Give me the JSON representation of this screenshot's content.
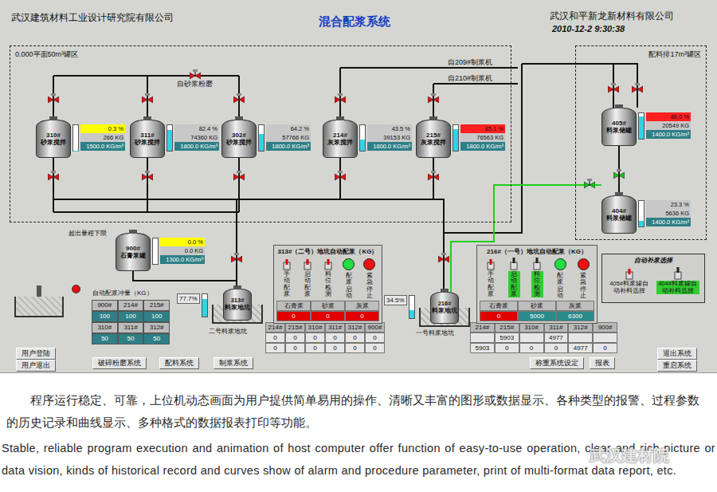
{
  "header": {
    "left_company": "武汉建筑材料工业设计研究院有限公司",
    "title": "混合配浆系统",
    "right_company": "武汉和平新龙新材料有限公司",
    "datetime": "2010-12-2 9:30:38"
  },
  "zones": [
    {
      "label": "0.000平面50m³罐区"
    },
    {
      "label": "配料排17m³罐区"
    }
  ],
  "sources": [
    "自砂浆粉磨",
    "自209#制浆机",
    "自210#制浆机"
  ],
  "alarm_text": "超出量程下限",
  "tanks": [
    {
      "id": "310#",
      "name": "砂浆搅拌",
      "percent": "0.3 %",
      "weight": "266 KG",
      "density": "1500.0 KG/m³",
      "level": 0.003,
      "color": "#ffff00"
    },
    {
      "id": "311#",
      "name": "砂浆搅拌",
      "percent": "82.4 %",
      "weight": "74360 KG",
      "density": "1800.0 KG/m³",
      "level": 0.824,
      "color": "#c8c8c8"
    },
    {
      "id": "302#",
      "name": "砂浆搅拌",
      "percent": "64.2 %",
      "weight": "57766 KG",
      "density": "1800.0 KG/m³",
      "level": 0.642,
      "color": "#c8c8c8"
    },
    {
      "id": "214#",
      "name": "灰浆搅拌",
      "percent": "43.5 %",
      "weight": "39153 KG",
      "density": "1800.0 KG/m³",
      "level": 0.435,
      "color": "#c8c8c8"
    },
    {
      "id": "215#",
      "name": "灰浆搅拌",
      "percent": "85.1 %",
      "weight": "76563 KG",
      "density": "1800.0 KG/m³",
      "level": 0.851,
      "color": "#ff2020"
    },
    {
      "id": "405#",
      "name": "料浆储罐",
      "percent": "86.0 %",
      "weight": "20549 KG",
      "density": "1400.0 KG/m³",
      "level": 0.86,
      "color": "#ff2020"
    },
    {
      "id": "404#",
      "name": "料浆储罐",
      "percent": "23.3 %",
      "weight": "5636 KG",
      "density": "1400.0 KG/m³",
      "level": 0.233,
      "color": "#c8c8c8"
    },
    {
      "id": "900#",
      "name": "石膏浆罐",
      "percent": "0.0 %",
      "weight": "0.0 KG",
      "density": "1300.0 KG/m³",
      "level": 0,
      "color": "#ffff00"
    }
  ],
  "pits": [
    {
      "id": "313#",
      "name": "料浆地坑",
      "caption": "二号料浆地坑",
      "percent": "77.7%",
      "level": 0.777
    },
    {
      "id": "216#",
      "name": "料浆地坑",
      "caption": "一号料浆地坑",
      "percent": "34.5%",
      "level": 0.345
    }
  ],
  "dosing_panels": [
    {
      "title": "313#（二号）地坑自动配浆（KG）",
      "controls": [
        {
          "label": "手动配浆",
          "kind": "switch",
          "on": false
        },
        {
          "label": "启动配浆",
          "kind": "switch",
          "on": false
        },
        {
          "label": "料位检测",
          "kind": "switch",
          "on": false
        },
        {
          "label": "配浆启动",
          "kind": "lamp",
          "color": "#22dd44"
        },
        {
          "label": "紧急停止",
          "kind": "lamp",
          "color": "#ee1111"
        }
      ],
      "materials": [
        {
          "name": "石膏浆",
          "value": "0",
          "color": "#e00000"
        },
        {
          "name": "砂浆",
          "value": "0",
          "color": "#e00000"
        },
        {
          "name": "灰浆",
          "value": "0",
          "color": "#e00000"
        }
      ]
    },
    {
      "title": "216#（一号）地坑自动配浆（KG）",
      "controls": [
        {
          "label": "手动配浆",
          "kind": "switch",
          "on": false
        },
        {
          "label": "启动配浆",
          "kind": "switch",
          "on": true
        },
        {
          "label": "料位检测",
          "kind": "switch",
          "on": true
        },
        {
          "label": "配浆启动",
          "kind": "lamp",
          "color": "#22dd44"
        },
        {
          "label": "紧急停止",
          "kind": "lamp",
          "color": "#ee1111"
        }
      ],
      "materials": [
        {
          "name": "石膏浆",
          "value": "0",
          "color": "#e00000"
        },
        {
          "name": "砂浆",
          "value": "5000",
          "color": "#2b8a8a"
        },
        {
          "name": "灰浆",
          "value": "6300",
          "color": "#2b8a8a"
        }
      ]
    }
  ],
  "auto_fill": {
    "title": "自动补浆选择",
    "options": [
      {
        "label": "405#料浆罐自动补料选择",
        "selected": false
      },
      {
        "label": "404#料浆罐自动补料选择",
        "selected": true
      }
    ]
  },
  "impulse": {
    "title": "自动配浆冲量（KG）",
    "groups": [
      {
        "headers": [
          "900#",
          "214#",
          "215#"
        ],
        "values": [
          "100",
          "100",
          "100"
        ]
      },
      {
        "headers": [
          "310#",
          "311#",
          "312#"
        ],
        "values": [
          "50",
          "50",
          "50"
        ]
      }
    ]
  },
  "totals_tables": [
    {
      "columns": [
        "214#",
        "215#",
        "310#",
        "311#",
        "312#",
        "900#"
      ],
      "rows": [
        [
          "0",
          "0",
          "0",
          "0",
          "0",
          "0"
        ],
        [
          "0",
          "0",
          "0",
          "0",
          "0",
          "0"
        ]
      ]
    },
    {
      "columns": [
        "214#",
        "215#",
        "310#",
        "311#",
        "312#",
        "900#"
      ],
      "rows": [
        [
          "",
          "5903",
          "",
          "4977",
          "",
          ""
        ],
        [
          "5903",
          "0",
          "0",
          "0",
          "4977",
          "0"
        ]
      ]
    }
  ],
  "valves": [
    {
      "open": false
    },
    {
      "open": false
    },
    {
      "open": false
    },
    {
      "open": false
    },
    {
      "open": false
    },
    {
      "open": false
    },
    {
      "open": false
    },
    {
      "open": false
    },
    {
      "open": false
    },
    {
      "open": false
    },
    {
      "open": false
    },
    {
      "open": false
    },
    {
      "open": false
    },
    {
      "open": true
    },
    {
      "open": true
    },
    {
      "open": false
    },
    {
      "open": false
    }
  ],
  "nav_buttons": [
    "用户登陆",
    "用户退出",
    "破碎粉磨系统",
    "配料系统",
    "制浆系统",
    "称重系统设定",
    "报表",
    "退出系统",
    "重启系统"
  ],
  "caption": {
    "zh": "程序运行稳定、可靠，上位机动态画面为用户提供简单易用的操作、清晰又丰富的图形或数据显示、各种类型的报警、过程参数的历史记录和曲线显示、多种格式的数据报表打印等功能。",
    "en": "Stable, reliable program execution and animation of host computer offer function of easy-to-use operation, clear and rich picture or data vision, kinds of historical record and curves show of alarm and procedure parameter, print of multi-format data report, etc."
  },
  "watermark": "武汉建材院"
}
